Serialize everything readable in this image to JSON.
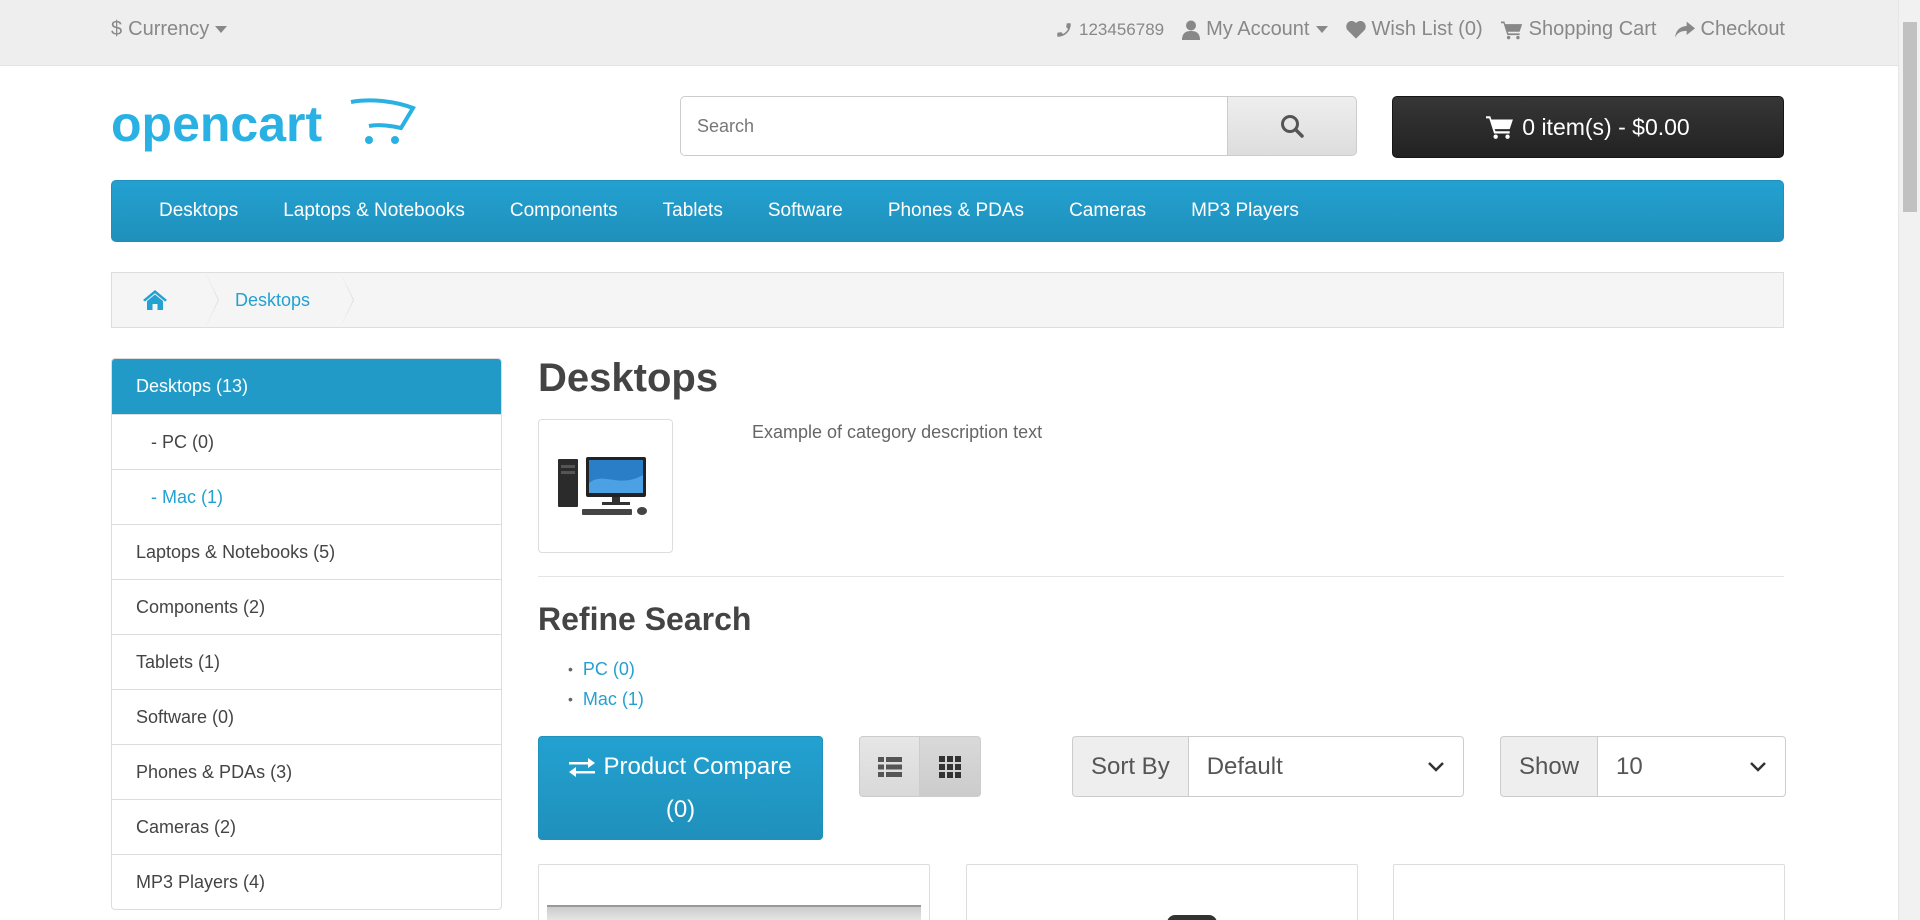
{
  "topbar": {
    "currency_label": "Currency",
    "currency_symbol": "$",
    "phone": "123456789",
    "my_account": "My Account",
    "wishlist": "Wish List (0)",
    "shopping_cart": "Shopping Cart",
    "checkout": "Checkout"
  },
  "header": {
    "logo_text": "opencart",
    "search_placeholder": "Search",
    "cart_label": "0 item(s) - $0.00"
  },
  "menu": [
    "Desktops",
    "Laptops & Notebooks",
    "Components",
    "Tablets",
    "Software",
    "Phones & PDAs",
    "Cameras",
    "MP3 Players"
  ],
  "breadcrumb": {
    "current": "Desktops"
  },
  "sidebar": [
    {
      "label": "Desktops (13)"
    },
    {
      "label": "- PC (0)"
    },
    {
      "label": "- Mac (1)"
    },
    {
      "label": "Laptops & Notebooks (5)"
    },
    {
      "label": "Components (2)"
    },
    {
      "label": "Tablets (1)"
    },
    {
      "label": "Software (0)"
    },
    {
      "label": "Phones & PDAs (3)"
    },
    {
      "label": "Cameras (2)"
    },
    {
      "label": "MP3 Players (4)"
    }
  ],
  "content": {
    "title": "Desktops",
    "description": "Example of category description text",
    "refine_title": "Refine Search",
    "refine_links": [
      "PC (0)",
      "Mac (1)"
    ],
    "compare_line1": "Product Compare",
    "compare_line2": "(0)",
    "sort_label": "Sort By",
    "sort_value": "Default",
    "show_label": "Show",
    "show_value": "10"
  },
  "colors": {
    "accent": "#229ac8",
    "link": "#23a1d1",
    "cart_button": "#222222"
  }
}
